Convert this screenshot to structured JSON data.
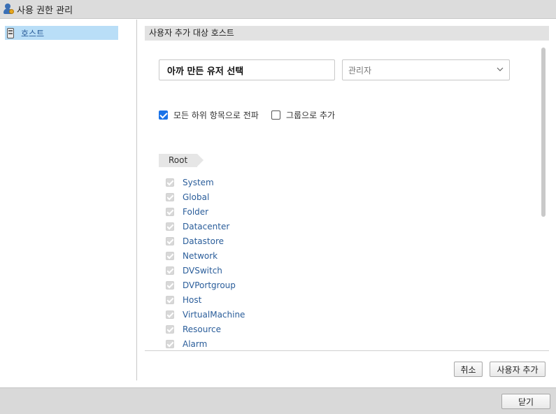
{
  "window": {
    "title": "사용 권한 관리"
  },
  "sidebar": {
    "items": [
      {
        "label": "호스트",
        "icon": "host-icon"
      }
    ]
  },
  "main": {
    "header": "사용자 추가 대상 호스트",
    "user_input": {
      "value": "아까 만든 유저 선택"
    },
    "role_select": {
      "selected": "관리자"
    },
    "options": {
      "propagate": {
        "label": "모든 하위 항목으로 전파",
        "checked": true
      },
      "add_as_group": {
        "label": "그룹으로 추가",
        "checked": false
      }
    },
    "breadcrumb": "Root",
    "privileges": [
      "System",
      "Global",
      "Folder",
      "Datacenter",
      "Datastore",
      "Network",
      "DVSwitch",
      "DVPortgroup",
      "Host",
      "VirtualMachine",
      "Resource",
      "Alarm"
    ],
    "buttons": {
      "cancel": "취소",
      "add_user": "사용자 추가"
    }
  },
  "footer": {
    "close": "닫기"
  },
  "colors": {
    "accent": "#1a73e8",
    "link": "#2a5d9a",
    "selection": "#b9def7"
  }
}
